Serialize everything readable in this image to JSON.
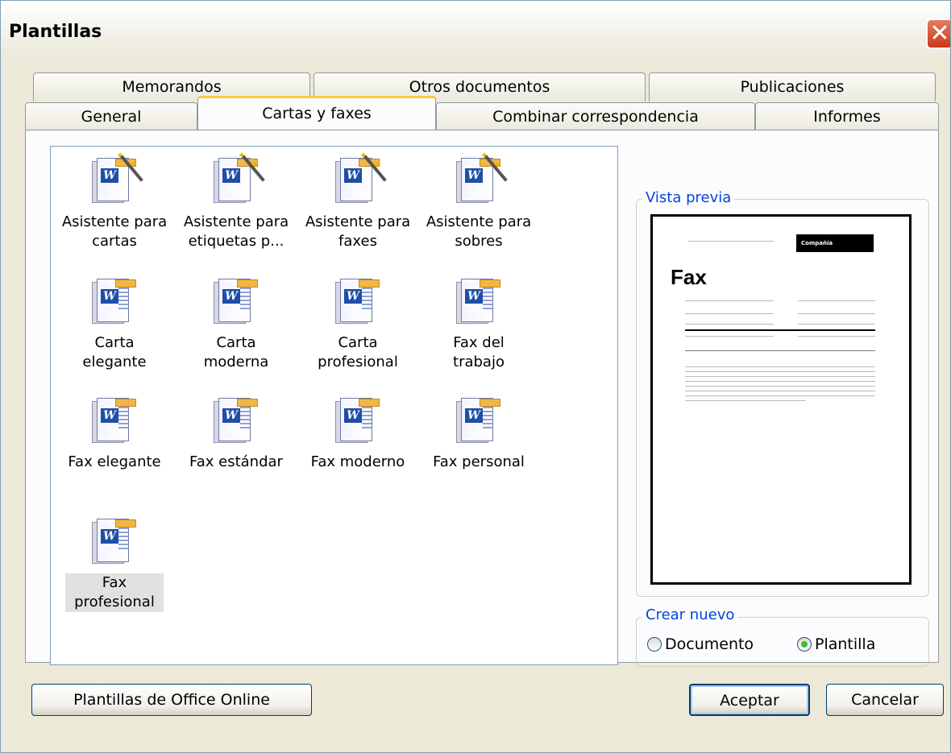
{
  "window": {
    "title": "Plantillas"
  },
  "tabs_row1": [
    {
      "label": "Memorandos"
    },
    {
      "label": "Otros documentos"
    },
    {
      "label": "Publicaciones"
    }
  ],
  "tabs_row2": [
    {
      "label": "General"
    },
    {
      "label": "Cartas y faxes",
      "active": true
    },
    {
      "label": "Combinar correspondencia"
    },
    {
      "label": "Informes"
    }
  ],
  "items": [
    {
      "label": "Asistente para cartas",
      "line1": "Asistente para",
      "line2": "cartas",
      "icon": "word-wizard-icon"
    },
    {
      "label": "Asistente para etiquetas p...",
      "line1": "Asistente para",
      "line2": "etiquetas p...",
      "icon": "word-wizard-icon"
    },
    {
      "label": "Asistente para faxes",
      "line1": "Asistente para",
      "line2": "faxes",
      "icon": "word-wizard-icon"
    },
    {
      "label": "Asistente para sobres",
      "line1": "Asistente para",
      "line2": "sobres",
      "icon": "word-wizard-icon"
    },
    {
      "label": "Carta elegante",
      "line1": "Carta",
      "line2": "elegante",
      "icon": "word-template-icon"
    },
    {
      "label": "Carta moderna",
      "line1": "Carta",
      "line2": "moderna",
      "icon": "word-template-icon"
    },
    {
      "label": "Carta profesional",
      "line1": "Carta",
      "line2": "profesional",
      "icon": "word-template-icon"
    },
    {
      "label": "Fax del trabajo",
      "line1": "Fax del",
      "line2": "trabajo",
      "icon": "word-template-icon"
    },
    {
      "label": "Fax elegante",
      "line1": "Fax elegante",
      "line2": "",
      "icon": "word-template-icon"
    },
    {
      "label": "Fax estándar",
      "line1": "Fax estándar",
      "line2": "",
      "icon": "word-template-icon"
    },
    {
      "label": "Fax moderno",
      "line1": "Fax moderno",
      "line2": "",
      "icon": "word-template-icon"
    },
    {
      "label": "Fax personal",
      "line1": "Fax personal",
      "line2": "",
      "icon": "word-template-icon"
    },
    {
      "label": "Fax profesional",
      "line1": "Fax",
      "line2": "profesional",
      "icon": "word-template-icon",
      "selected": true
    }
  ],
  "view_buttons": [
    "large-icons-view-icon",
    "list-view-icon",
    "details-view-icon"
  ],
  "preview": {
    "group_label": "Vista previa",
    "doc_company": "Compañía",
    "doc_title": "Fax"
  },
  "create_new": {
    "group_label": "Crear nuevo",
    "options": [
      {
        "label": "Documento",
        "checked": false
      },
      {
        "label": "Plantilla",
        "checked": true
      }
    ]
  },
  "buttons": {
    "online": "Plantillas de Office Online",
    "ok": "Aceptar",
    "cancel": "Cancelar"
  },
  "colors": {
    "dialog_bg": "#ece9d8",
    "accent_tab": "#ffc83c",
    "group_label": "#0046d5",
    "close": "#c9391a"
  }
}
